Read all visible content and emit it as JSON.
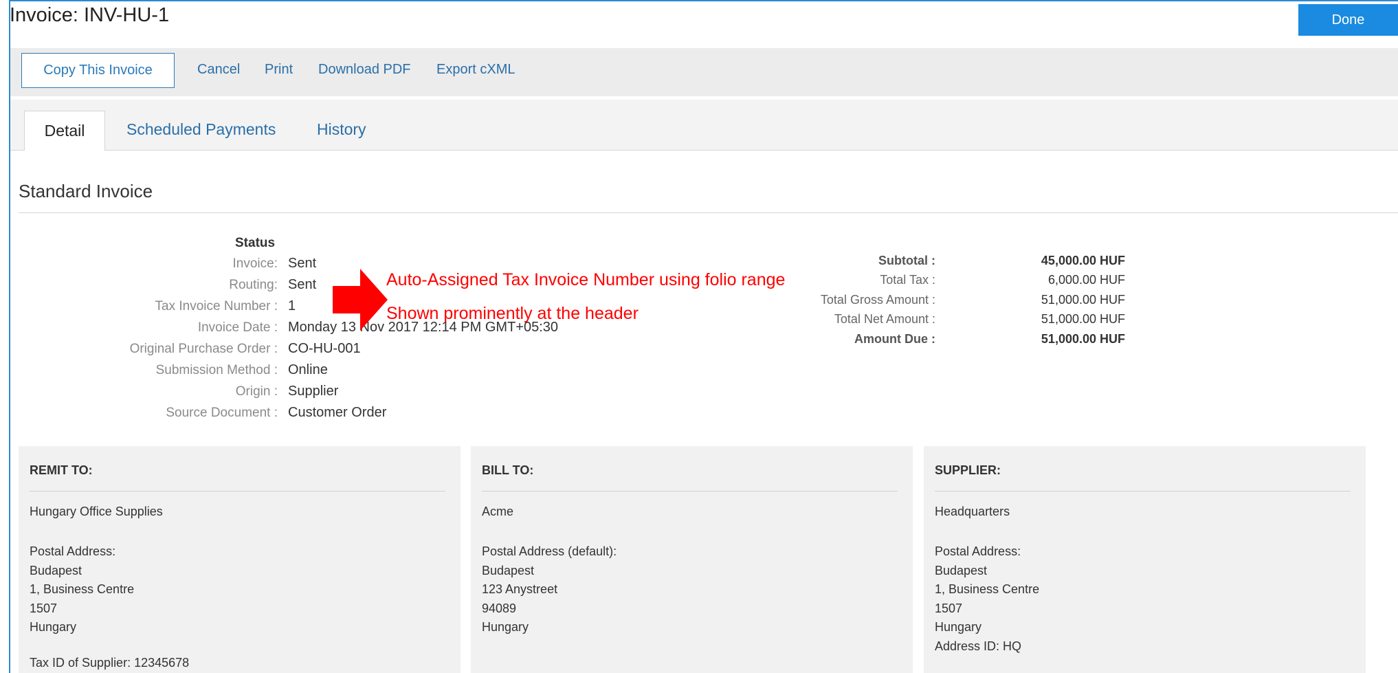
{
  "header": {
    "title": "Invoice: INV-HU-1",
    "done_label": "Done"
  },
  "toolbar": {
    "copy_label": "Copy This Invoice",
    "cancel_label": "Cancel",
    "print_label": "Print",
    "download_pdf_label": "Download PDF",
    "export_cxml_label": "Export cXML"
  },
  "tabs": [
    {
      "label": "Detail",
      "active": true
    },
    {
      "label": "Scheduled Payments"
    },
    {
      "label": "History"
    }
  ],
  "section_title": "Standard Invoice",
  "status": {
    "heading": "Status",
    "rows": [
      {
        "label": "Invoice:",
        "value": "Sent"
      },
      {
        "label": "Routing:",
        "value": "Sent"
      },
      {
        "label": "Tax Invoice Number :",
        "value": "1"
      },
      {
        "label": "Invoice Date :",
        "value": "Monday 13 Nov 2017 12:14 PM GMT+05:30"
      },
      {
        "label": "Original Purchase Order :",
        "value": "CO-HU-001"
      },
      {
        "label": "Submission Method :",
        "value": "Online"
      },
      {
        "label": "Origin :",
        "value": "Supplier"
      },
      {
        "label": "Source Document :",
        "value": "Customer Order"
      }
    ]
  },
  "totals": [
    {
      "label": "Subtotal :",
      "value": "45,000.00 HUF",
      "bold": true
    },
    {
      "label": "Total Tax :",
      "value": "6,000.00 HUF"
    },
    {
      "label": "Total Gross Amount :",
      "value": "51,000.00 HUF"
    },
    {
      "label": "Total Net Amount :",
      "value": "51,000.00 HUF"
    },
    {
      "label": "Amount Due :",
      "value": "51,000.00 HUF",
      "bold": true
    }
  ],
  "annotation": {
    "line1": "Auto-Assigned Tax Invoice Number using folio range",
    "line2": "Shown prominently at the header",
    "color": "#ff0000"
  },
  "remit_to": {
    "title": "REMIT TO:",
    "name": "Hungary Office Supplies",
    "lines": [
      "Postal Address:",
      "Budapest",
      "1, Business Centre",
      "1507",
      "Hungary"
    ],
    "tax_id": "Tax ID of Supplier:  12345678"
  },
  "bill_to": {
    "title": "BILL TO:",
    "name": "Acme",
    "lines": [
      "Postal Address (default):",
      "Budapest",
      "123 Anystreet",
      "94089",
      "Hungary"
    ]
  },
  "supplier": {
    "title": "SUPPLIER:",
    "name": "Headquarters",
    "lines": [
      "Postal Address:",
      "Budapest",
      "1, Business Centre",
      "1507",
      "Hungary",
      "Address ID: HQ"
    ]
  },
  "colors": {
    "accent": "#1a8be0",
    "link": "#2a6fa8"
  }
}
